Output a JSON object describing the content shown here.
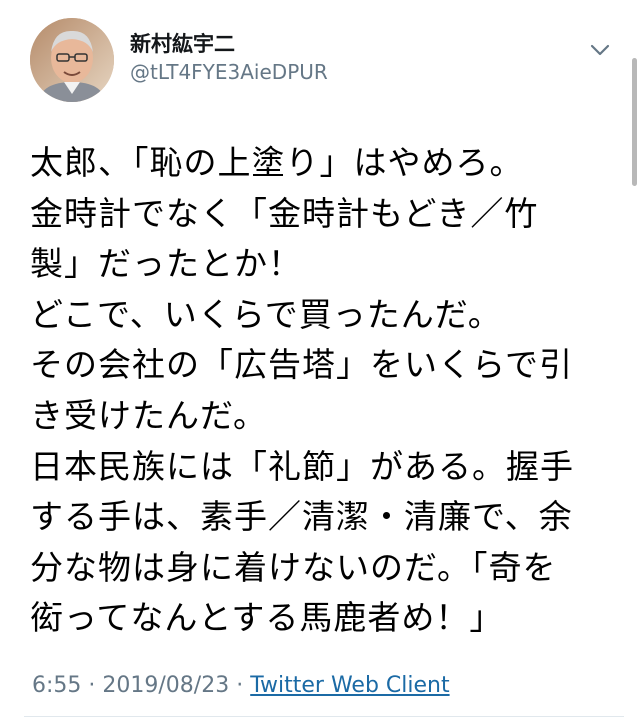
{
  "user": {
    "display_name": "新村紘宇二",
    "handle": "@tLT4FYE3AieDPUR",
    "avatar_icon": "user-avatar-photo"
  },
  "menu_icon": "chevron-down-icon",
  "tweet": {
    "lines": [
      "太郎、「恥の上塗り」はやめろ。",
      "金時計でなく「金時計もどき／竹",
      "製」だったとか！",
      "どこで、いくらで買ったんだ。",
      "その会社の「広告塔」をいくらで引",
      "き受けたんだ。",
      "日本民族には「礼節」がある。握手",
      "する手は、素手／清潔・清廉で、余",
      "分な物は身に着けないのだ。「奇を",
      "衒ってなんとする馬鹿者め！」"
    ]
  },
  "meta": {
    "time": "6:55",
    "date": "2019/08/23",
    "separator": "·",
    "client": "Twitter Web Client"
  },
  "colors": {
    "text": "#000000",
    "secondary": "#657786",
    "link": "#1b6aa5",
    "divider": "#e1e8ed"
  }
}
